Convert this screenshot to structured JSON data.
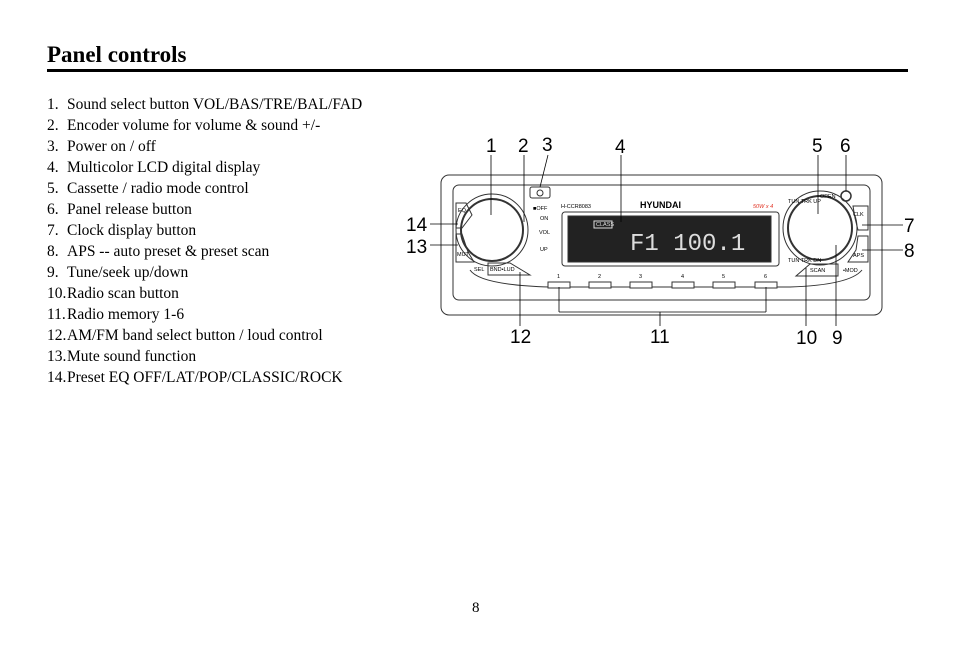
{
  "heading": "Panel controls",
  "items": [
    {
      "n": "1.",
      "text": "Sound select button VOL/BAS/TRE/BAL/FAD"
    },
    {
      "n": "2.",
      "text": "Encoder volume for volume & sound +/-"
    },
    {
      "n": "3.",
      "text": "Power on / off"
    },
    {
      "n": "4.",
      "text": "Multicolor LCD digital display"
    },
    {
      "n": "5.",
      "text": "Cassette / radio mode control"
    },
    {
      "n": "6.",
      "text": "Panel release button"
    },
    {
      "n": "7.",
      "text": "Clock display button"
    },
    {
      "n": "8.",
      "text": "APS -- auto preset & preset scan"
    },
    {
      "n": "9.",
      "text": "Tune/seek up/down"
    },
    {
      "n": "10.",
      "text": "Radio scan button"
    },
    {
      "n": "11.",
      "text": "Radio memory 1-6"
    },
    {
      "n": "12.",
      "text": "AM/FM band select button / loud control"
    },
    {
      "n": "13.",
      "text": "Mute sound function"
    },
    {
      "n": "14.",
      "text": "Preset EQ OFF/LAT/POP/CLASSIC/ROCK"
    }
  ],
  "diagram": {
    "callouts": [
      "1",
      "2",
      "3",
      "4",
      "5",
      "6",
      "7",
      "8",
      "9",
      "10",
      "11",
      "12",
      "13",
      "14"
    ],
    "model": "H-CCR8083",
    "brand": "HYUNDAI",
    "power_rating": "50W x 4",
    "lcd_text": "F1 100.1",
    "labels": {
      "eq": "EQ",
      "mut": "MUT",
      "sel": "SEL",
      "bnd": "BND•LUD",
      "off": "■OFF",
      "on": "ON",
      "vol": "VOL",
      "up": "UP",
      "open": "OPEN",
      "clk": "CLK",
      "aps": "APS",
      "mod": "•MOD",
      "scan": "SCAN",
      "tun_up": "TUN TRK UP",
      "tun_dn": "TUN TRK DN",
      "classic": "CLASS"
    },
    "presets": [
      "1",
      "2",
      "3",
      "4",
      "5",
      "6"
    ],
    "accent_color": "#e03020"
  },
  "page_number": "8"
}
